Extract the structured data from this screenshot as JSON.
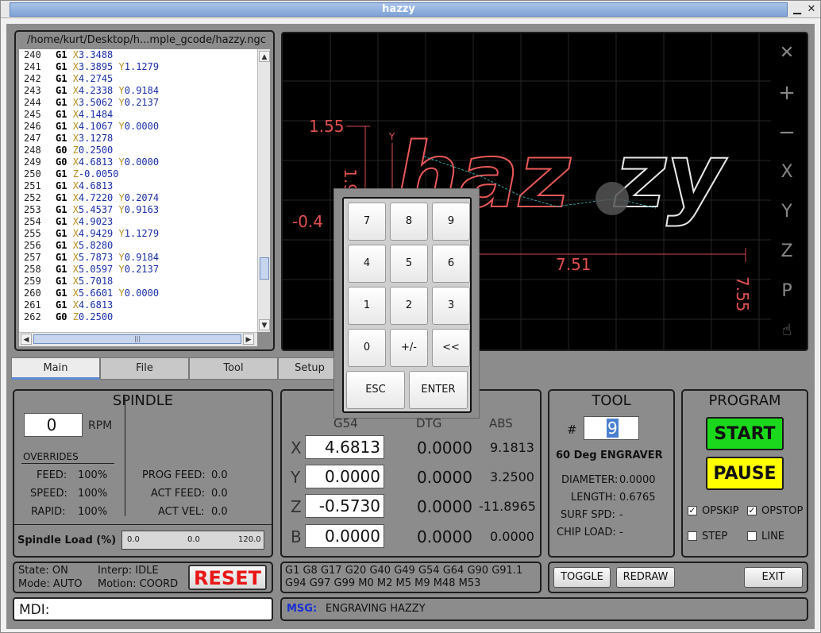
{
  "window": {
    "title": "hazzy"
  },
  "gcode": {
    "path": "/home/kurt/Desktop/h...mple_gcode/hazzy.ngc",
    "lines": [
      {
        "n": "240",
        "cmd": "G1",
        "parts": [
          [
            "X",
            "3.3488"
          ]
        ]
      },
      {
        "n": "241",
        "cmd": "G1",
        "parts": [
          [
            "X",
            "3.3895"
          ],
          [
            "Y",
            "1.1279"
          ]
        ]
      },
      {
        "n": "242",
        "cmd": "G1",
        "parts": [
          [
            "X",
            "4.2745"
          ]
        ]
      },
      {
        "n": "243",
        "cmd": "G1",
        "parts": [
          [
            "X",
            "4.2338"
          ],
          [
            "Y",
            "0.9184"
          ]
        ]
      },
      {
        "n": "244",
        "cmd": "G1",
        "parts": [
          [
            "X",
            "3.5062"
          ],
          [
            "Y",
            "0.2137"
          ]
        ]
      },
      {
        "n": "245",
        "cmd": "G1",
        "parts": [
          [
            "X",
            "4.1484"
          ]
        ]
      },
      {
        "n": "246",
        "cmd": "G1",
        "parts": [
          [
            "X",
            "4.1067"
          ],
          [
            "Y",
            "0.0000"
          ]
        ]
      },
      {
        "n": "247",
        "cmd": "G1",
        "parts": [
          [
            "X",
            "3.1278"
          ]
        ]
      },
      {
        "n": "248",
        "cmd": "G0",
        "parts": [
          [
            "Z",
            "0.2500"
          ]
        ]
      },
      {
        "n": "249",
        "cmd": "G0",
        "parts": [
          [
            "X",
            "4.6813"
          ],
          [
            "Y",
            "0.0000"
          ]
        ]
      },
      {
        "n": "250",
        "cmd": "G1",
        "parts": [
          [
            "Z",
            "-0.0050"
          ]
        ]
      },
      {
        "n": "251",
        "cmd": "G1",
        "parts": [
          [
            "X",
            "4.6813"
          ]
        ]
      },
      {
        "n": "252",
        "cmd": "G1",
        "parts": [
          [
            "X",
            "4.7220"
          ],
          [
            "Y",
            "0.2074"
          ]
        ]
      },
      {
        "n": "253",
        "cmd": "G1",
        "parts": [
          [
            "X",
            "5.4537"
          ],
          [
            "Y",
            "0.9163"
          ]
        ]
      },
      {
        "n": "254",
        "cmd": "G1",
        "parts": [
          [
            "X",
            "4.9023"
          ]
        ]
      },
      {
        "n": "255",
        "cmd": "G1",
        "parts": [
          [
            "X",
            "4.9429"
          ],
          [
            "Y",
            "1.1279"
          ]
        ]
      },
      {
        "n": "256",
        "cmd": "G1",
        "parts": [
          [
            "X",
            "5.8280"
          ]
        ]
      },
      {
        "n": "257",
        "cmd": "G1",
        "parts": [
          [
            "X",
            "5.7873"
          ],
          [
            "Y",
            "0.9184"
          ]
        ]
      },
      {
        "n": "258",
        "cmd": "G1",
        "parts": [
          [
            "X",
            "5.0597"
          ],
          [
            "Y",
            "0.2137"
          ]
        ]
      },
      {
        "n": "259",
        "cmd": "G1",
        "parts": [
          [
            "X",
            "5.7018"
          ]
        ]
      },
      {
        "n": "260",
        "cmd": "G1",
        "parts": [
          [
            "X",
            "5.6601"
          ],
          [
            "Y",
            "0.0000"
          ]
        ]
      },
      {
        "n": "261",
        "cmd": "G1",
        "parts": [
          [
            "X",
            "4.6813"
          ]
        ]
      },
      {
        "n": "262",
        "cmd": "G0",
        "parts": [
          [
            "Z",
            "0.2500"
          ]
        ]
      }
    ]
  },
  "preview": {
    "text": "hazzy",
    "dims": {
      "top": "1.55",
      "left_vertical": "1.99",
      "left_neg": "-0.4",
      "width": "7.51",
      "right_vertical": "7.55"
    },
    "axis_y": "Y",
    "tools": [
      "tools-icon",
      "zoom-in-icon",
      "zoom-out-icon",
      "X",
      "Y",
      "Z",
      "P",
      "hand-icon"
    ]
  },
  "tabs": [
    "Main",
    "File",
    "Tool",
    "Setup"
  ],
  "keypad": {
    "keys": [
      "7",
      "8",
      "9",
      "4",
      "5",
      "6",
      "1",
      "2",
      "3",
      "0",
      "+/-",
      "<<"
    ],
    "esc": "ESC",
    "enter": "ENTER"
  },
  "spindle": {
    "title": "SPINDLE",
    "rpm": "0",
    "rpm_unit": "RPM",
    "overrides_label": "OVERRIDES",
    "feed_label": "FEED:",
    "feed": "100%",
    "speed_label": "SPEED:",
    "speed": "100%",
    "rapid_label": "RAPID:",
    "rapid": "100%",
    "prog_feed_label": "PROG FEED:",
    "prog_feed": "0.0",
    "act_feed_label": "ACT FEED:",
    "act_feed": "0.0",
    "act_vel_label": "ACT VEL:",
    "act_vel": "0.0",
    "load_label": "Spindle Load (%)",
    "load_ticks": [
      "0.0",
      "0.0",
      "120.0"
    ],
    "load_fraction": 0
  },
  "dro": {
    "headers": [
      "G54",
      "DTG",
      "ABS"
    ],
    "axes": [
      {
        "axis": "X",
        "g54": "4.6813",
        "dtg": "0.0000",
        "abs": "9.1813"
      },
      {
        "axis": "Y",
        "g54": "0.0000",
        "dtg": "0.0000",
        "abs": "3.2500"
      },
      {
        "axis": "Z",
        "g54": "-0.5730",
        "dtg": "0.0000",
        "abs": "-11.8965"
      },
      {
        "axis": "B",
        "g54": "0.0000",
        "dtg": "0.0000",
        "abs": "0.0000"
      }
    ]
  },
  "tool": {
    "title": "TOOL",
    "hash": "#",
    "number": "9",
    "name": "60 Deg ENGRAVER",
    "diameter_label": "DIAMETER:",
    "diameter": "0.0000",
    "length_label": "LENGTH:",
    "length": "0.6765",
    "surf_label": "SURF SPD:",
    "surf": "-",
    "chip_label": "CHIP LOAD:",
    "chip": "-"
  },
  "program": {
    "title": "PROGRAM",
    "start": "START",
    "pause": "PAUSE",
    "opskip": "OPSKIP",
    "opskip_checked": true,
    "opstop": "OPSTOP",
    "opstop_checked": true,
    "step": "STEP",
    "step_checked": false,
    "line": "LINE",
    "line_checked": false
  },
  "status": {
    "state": "State: ON",
    "mode": "Mode: AUTO",
    "interp": "Interp: IDLE",
    "motion": "Motion: COORD",
    "reset": "RESET"
  },
  "gcodes_active": {
    "line1": "G1 G8 G17 G20 G40 G49 G54 G64 G90 G91.1",
    "line2": "G94 G97 G99 M0 M2 M5 M9 M48 M53"
  },
  "buttons": {
    "toggle": "TOGGLE",
    "redraw": "REDRAW",
    "exit": "EXIT"
  },
  "mdi": {
    "label": "MDI:"
  },
  "msg": {
    "label": "MSG:",
    "text": "ENGRAVING HAZZY"
  },
  "colors": {
    "start": "#1cd81c",
    "pause": "#ffff00",
    "reset": "#e81818",
    "dim": "#e05050",
    "msg": "#1a2fd0"
  }
}
